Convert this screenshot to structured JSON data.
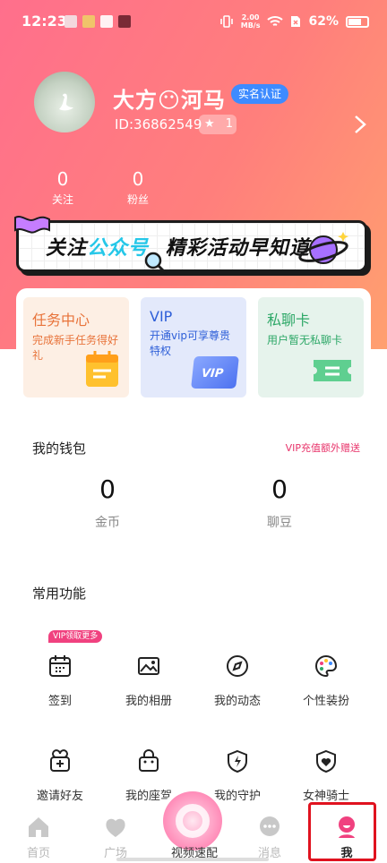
{
  "status_bar": {
    "time": "12:23",
    "network_speed_value": "2.00",
    "network_speed_unit": "MB/s",
    "battery": "62%"
  },
  "profile": {
    "nickname": "大方😶河马",
    "verify_badge": "实名认证",
    "user_id": "ID:36862549",
    "level": "1"
  },
  "stats": [
    {
      "value": "0",
      "label": "关注"
    },
    {
      "value": "0",
      "label": "粉丝"
    }
  ],
  "banner": {
    "text_before": "关注",
    "text_highlight": "公众号",
    "text_after": "精彩活动早知道"
  },
  "cards": [
    {
      "title": "任务中心",
      "desc": "完成新手任务得好礼"
    },
    {
      "title": "VIP",
      "desc": "开通vip可享尊贵特权",
      "deco_text": "VIP"
    },
    {
      "title": "私聊卡",
      "desc": "用户暂无私聊卡"
    }
  ],
  "wallet": {
    "title": "我的钱包",
    "link": "VIP充值额外赠送",
    "items": [
      {
        "value": "0",
        "label": "金币"
      },
      {
        "value": "0",
        "label": "聊豆"
      }
    ]
  },
  "functions": {
    "title": "常用功能",
    "vip_tag": "VIP领取更多",
    "items": [
      {
        "label": "签到",
        "icon": "calendar-icon"
      },
      {
        "label": "我的相册",
        "icon": "image-icon"
      },
      {
        "label": "我的动态",
        "icon": "compass-icon"
      },
      {
        "label": "个性装扮",
        "icon": "palette-icon"
      },
      {
        "label": "邀请好友",
        "icon": "gift-icon"
      },
      {
        "label": "我的座驾",
        "icon": "bag-icon"
      },
      {
        "label": "我的守护",
        "icon": "shield-bolt-icon"
      },
      {
        "label": "女神骑士",
        "icon": "shield-heart-icon"
      }
    ]
  },
  "tabbar": {
    "tabs": [
      {
        "label": "首页",
        "icon": "home-icon"
      },
      {
        "label": "广场",
        "icon": "square-icon"
      },
      {
        "label": "视频速配",
        "icon": "video-match-icon"
      },
      {
        "label": "消息",
        "icon": "message-icon"
      },
      {
        "label": "我",
        "icon": "me-icon"
      }
    ],
    "active": "我",
    "accent": "#f0417f"
  },
  "colors": {
    "header_gradient_start": "#ff6f8c",
    "header_gradient_end": "#ffa06f",
    "verify_blue": "#3e8bff",
    "link_pink": "#e8336a"
  }
}
